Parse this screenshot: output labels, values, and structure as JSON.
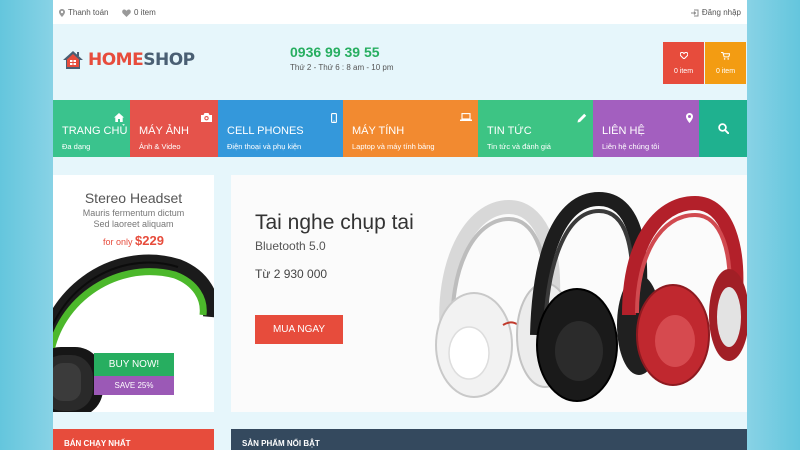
{
  "topbar": {
    "checkout_label": "Thanh toán",
    "wishlist_label": "0 item",
    "login_label": "Đăng nhập"
  },
  "header": {
    "logo": {
      "part1": "HOME",
      "part2": "SHOP"
    },
    "phone": "0936 99 39 55",
    "hours": "Thứ 2 - Thứ 6 : 8 am - 10 pm",
    "wishlist_box": {
      "count": "0 item",
      "icon": "heart-icon",
      "color": "#e74c3c"
    },
    "cart_box": {
      "count": "0 item",
      "icon": "cart-icon",
      "color": "#f39c12"
    }
  },
  "nav": {
    "items": [
      {
        "label": "Trang chủ",
        "sub": "Đa dạng",
        "icon": "home-icon",
        "color": "#3ac38d"
      },
      {
        "label": "Máy ảnh",
        "sub": "Ảnh & Video",
        "icon": "camera-icon",
        "color": "#e5534b"
      },
      {
        "label": "Cell phones",
        "sub": "Điện thoại và phụ kiện",
        "icon": "mobile-icon",
        "color": "#3498db"
      },
      {
        "label": "Máy tính",
        "sub": "Laptop và máy tính bảng",
        "icon": "laptop-icon",
        "color": "#f28a30"
      },
      {
        "label": "Tin tức",
        "sub": "Tin tức và đánh giá",
        "icon": "pencil-icon",
        "color": "#3dc484"
      },
      {
        "label": "Liên hệ",
        "sub": "Liên hệ chúng tôi",
        "icon": "map-marker-icon",
        "color": "#a35fbf"
      }
    ],
    "search_icon": "search-icon",
    "search_color": "#1fb18f"
  },
  "promo": {
    "title": "Stereo Headset",
    "desc_line1": "Mauris fermentum dictum",
    "desc_line2": "Sed laoreet aliquam",
    "price_prefix": "for only",
    "price": "$229",
    "buy_label": "Buy now!",
    "save_label": "Save 25%"
  },
  "hero": {
    "title": "Tai nghe chụp tai",
    "subtitle": "Bluetooth 5.0",
    "price": "Từ 2 930 000",
    "button": "Mua ngay"
  },
  "sections": {
    "bestseller": "Bán chạy nhất",
    "featured": "Sản phẩm nổi bật"
  },
  "colors": {
    "accent_red": "#e74c3c",
    "accent_green": "#27ae60",
    "accent_purple": "#9b59b6",
    "dark": "#34495e"
  }
}
